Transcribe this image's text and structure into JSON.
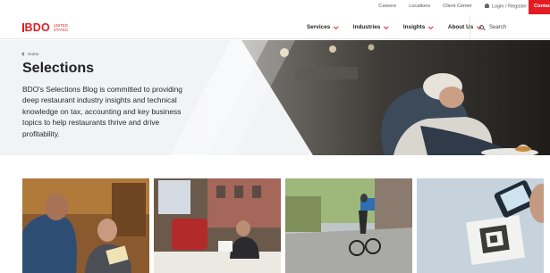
{
  "utility_nav": {
    "links": [
      "Careers",
      "Locations",
      "Client Center"
    ],
    "login_label": "Login / Register",
    "cta_label": "Contact"
  },
  "brand": {
    "logo_text": "BDO",
    "logo_subtitle_line1": "UNITED",
    "logo_subtitle_line2": "STATES",
    "accent_color": "#e31b23"
  },
  "main_nav": {
    "items": [
      "Services",
      "Industries",
      "Insights",
      "About Us"
    ],
    "search_label": "Search"
  },
  "hero": {
    "breadcrumb": "Home",
    "title": "Selections",
    "description": "BDO's Selections Blog is committed to providing deep restaurant industry insights and technical knowledge on tax, accounting and key business topics to help restaurants thrive and drive profitability."
  },
  "cards": [
    {
      "icon": "people-reviewing-document-photo"
    },
    {
      "icon": "restaurant-interior-photo"
    },
    {
      "icon": "delivery-cyclist-photo"
    },
    {
      "icon": "qr-code-phone-photo"
    }
  ]
}
